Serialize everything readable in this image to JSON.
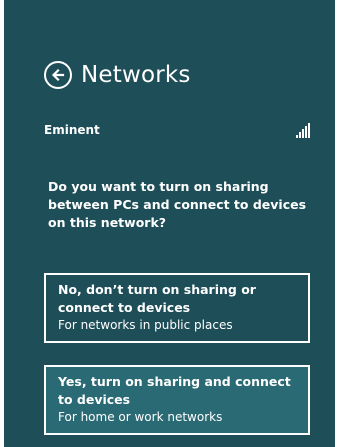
{
  "header": {
    "back_icon": "back-arrow-circle-icon",
    "title": "Networks"
  },
  "network": {
    "name": "Eminent",
    "signal_icon": "signal-strength-icon",
    "signal_bars": 5
  },
  "prompt": {
    "question": "Do you want to turn on sharing between PCs and connect to devices on this network?"
  },
  "options": [
    {
      "title": "No, don’t turn on sharing or connect to devices",
      "subtitle": "For networks in public places"
    },
    {
      "title": "Yes, turn on sharing and connect to devices",
      "subtitle": "For home or work networks"
    }
  ],
  "colors": {
    "panel_background": "#1e4e58",
    "selected_option": "#2a6a74",
    "text": "#ffffff"
  }
}
